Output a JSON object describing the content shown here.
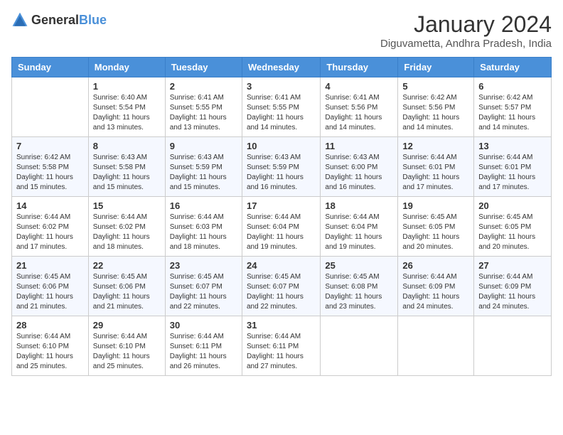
{
  "header": {
    "logo_general": "General",
    "logo_blue": "Blue",
    "month_year": "January 2024",
    "location": "Diguvametta, Andhra Pradesh, India"
  },
  "weekdays": [
    "Sunday",
    "Monday",
    "Tuesday",
    "Wednesday",
    "Thursday",
    "Friday",
    "Saturday"
  ],
  "weeks": [
    [
      {
        "day": "",
        "info": ""
      },
      {
        "day": "1",
        "info": "Sunrise: 6:40 AM\nSunset: 5:54 PM\nDaylight: 11 hours\nand 13 minutes."
      },
      {
        "day": "2",
        "info": "Sunrise: 6:41 AM\nSunset: 5:55 PM\nDaylight: 11 hours\nand 13 minutes."
      },
      {
        "day": "3",
        "info": "Sunrise: 6:41 AM\nSunset: 5:55 PM\nDaylight: 11 hours\nand 14 minutes."
      },
      {
        "day": "4",
        "info": "Sunrise: 6:41 AM\nSunset: 5:56 PM\nDaylight: 11 hours\nand 14 minutes."
      },
      {
        "day": "5",
        "info": "Sunrise: 6:42 AM\nSunset: 5:56 PM\nDaylight: 11 hours\nand 14 minutes."
      },
      {
        "day": "6",
        "info": "Sunrise: 6:42 AM\nSunset: 5:57 PM\nDaylight: 11 hours\nand 14 minutes."
      }
    ],
    [
      {
        "day": "7",
        "info": "Sunrise: 6:42 AM\nSunset: 5:58 PM\nDaylight: 11 hours\nand 15 minutes."
      },
      {
        "day": "8",
        "info": "Sunrise: 6:43 AM\nSunset: 5:58 PM\nDaylight: 11 hours\nand 15 minutes."
      },
      {
        "day": "9",
        "info": "Sunrise: 6:43 AM\nSunset: 5:59 PM\nDaylight: 11 hours\nand 15 minutes."
      },
      {
        "day": "10",
        "info": "Sunrise: 6:43 AM\nSunset: 5:59 PM\nDaylight: 11 hours\nand 16 minutes."
      },
      {
        "day": "11",
        "info": "Sunrise: 6:43 AM\nSunset: 6:00 PM\nDaylight: 11 hours\nand 16 minutes."
      },
      {
        "day": "12",
        "info": "Sunrise: 6:44 AM\nSunset: 6:01 PM\nDaylight: 11 hours\nand 17 minutes."
      },
      {
        "day": "13",
        "info": "Sunrise: 6:44 AM\nSunset: 6:01 PM\nDaylight: 11 hours\nand 17 minutes."
      }
    ],
    [
      {
        "day": "14",
        "info": "Sunrise: 6:44 AM\nSunset: 6:02 PM\nDaylight: 11 hours\nand 17 minutes."
      },
      {
        "day": "15",
        "info": "Sunrise: 6:44 AM\nSunset: 6:02 PM\nDaylight: 11 hours\nand 18 minutes."
      },
      {
        "day": "16",
        "info": "Sunrise: 6:44 AM\nSunset: 6:03 PM\nDaylight: 11 hours\nand 18 minutes."
      },
      {
        "day": "17",
        "info": "Sunrise: 6:44 AM\nSunset: 6:04 PM\nDaylight: 11 hours\nand 19 minutes."
      },
      {
        "day": "18",
        "info": "Sunrise: 6:44 AM\nSunset: 6:04 PM\nDaylight: 11 hours\nand 19 minutes."
      },
      {
        "day": "19",
        "info": "Sunrise: 6:45 AM\nSunset: 6:05 PM\nDaylight: 11 hours\nand 20 minutes."
      },
      {
        "day": "20",
        "info": "Sunrise: 6:45 AM\nSunset: 6:05 PM\nDaylight: 11 hours\nand 20 minutes."
      }
    ],
    [
      {
        "day": "21",
        "info": "Sunrise: 6:45 AM\nSunset: 6:06 PM\nDaylight: 11 hours\nand 21 minutes."
      },
      {
        "day": "22",
        "info": "Sunrise: 6:45 AM\nSunset: 6:06 PM\nDaylight: 11 hours\nand 21 minutes."
      },
      {
        "day": "23",
        "info": "Sunrise: 6:45 AM\nSunset: 6:07 PM\nDaylight: 11 hours\nand 22 minutes."
      },
      {
        "day": "24",
        "info": "Sunrise: 6:45 AM\nSunset: 6:07 PM\nDaylight: 11 hours\nand 22 minutes."
      },
      {
        "day": "25",
        "info": "Sunrise: 6:45 AM\nSunset: 6:08 PM\nDaylight: 11 hours\nand 23 minutes."
      },
      {
        "day": "26",
        "info": "Sunrise: 6:44 AM\nSunset: 6:09 PM\nDaylight: 11 hours\nand 24 minutes."
      },
      {
        "day": "27",
        "info": "Sunrise: 6:44 AM\nSunset: 6:09 PM\nDaylight: 11 hours\nand 24 minutes."
      }
    ],
    [
      {
        "day": "28",
        "info": "Sunrise: 6:44 AM\nSunset: 6:10 PM\nDaylight: 11 hours\nand 25 minutes."
      },
      {
        "day": "29",
        "info": "Sunrise: 6:44 AM\nSunset: 6:10 PM\nDaylight: 11 hours\nand 25 minutes."
      },
      {
        "day": "30",
        "info": "Sunrise: 6:44 AM\nSunset: 6:11 PM\nDaylight: 11 hours\nand 26 minutes."
      },
      {
        "day": "31",
        "info": "Sunrise: 6:44 AM\nSunset: 6:11 PM\nDaylight: 11 hours\nand 27 minutes."
      },
      {
        "day": "",
        "info": ""
      },
      {
        "day": "",
        "info": ""
      },
      {
        "day": "",
        "info": ""
      }
    ]
  ]
}
